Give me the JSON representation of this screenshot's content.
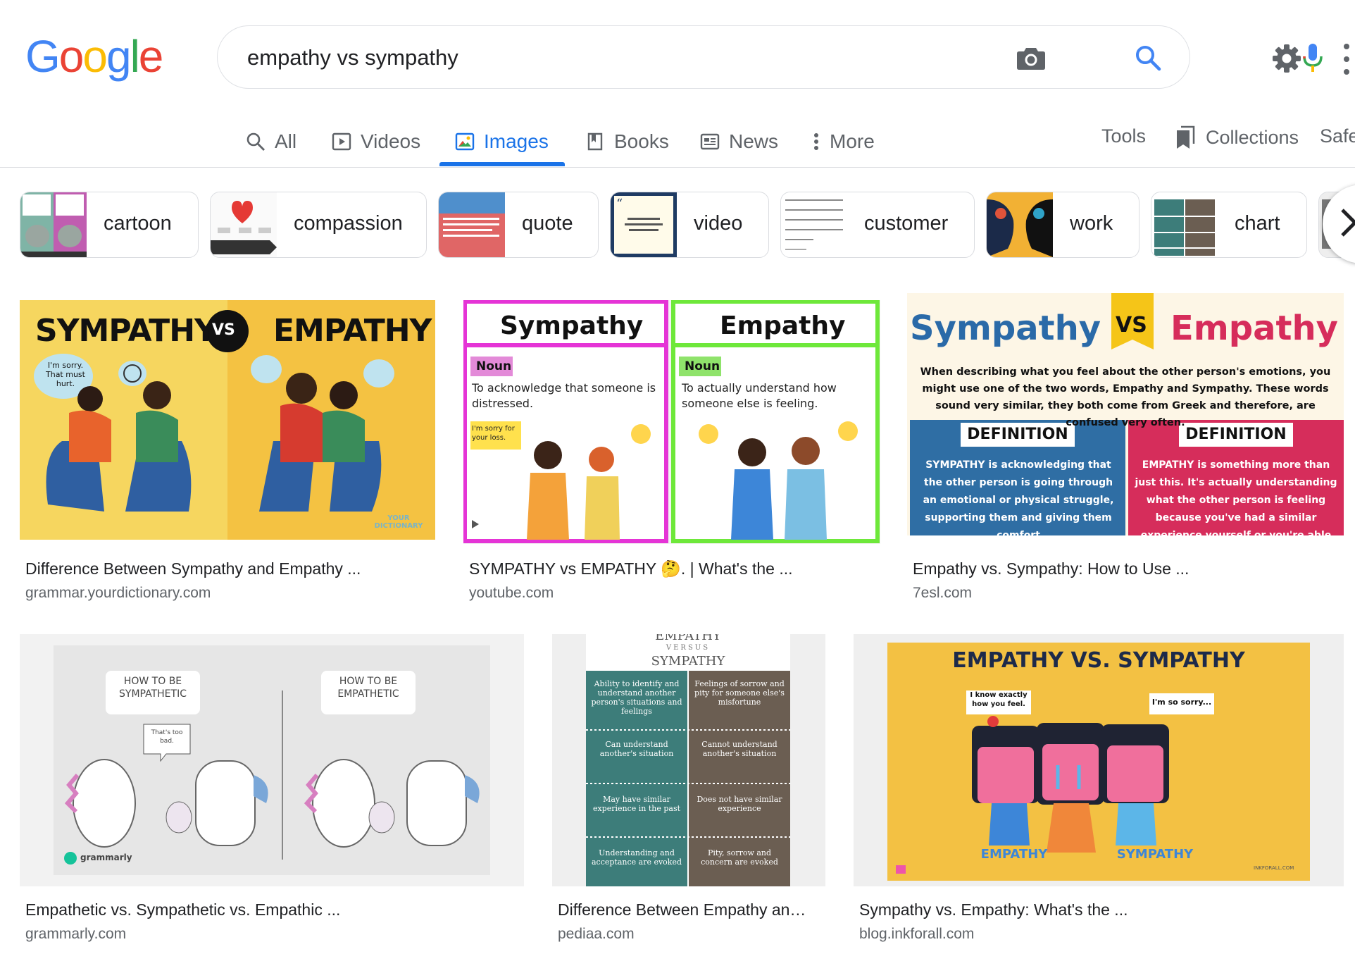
{
  "header": {
    "logo_letters": [
      {
        "ch": "G",
        "color": "#4285F4"
      },
      {
        "ch": "o",
        "color": "#EA4335"
      },
      {
        "ch": "o",
        "color": "#FBBC05"
      },
      {
        "ch": "g",
        "color": "#4285F4"
      },
      {
        "ch": "l",
        "color": "#34A853"
      },
      {
        "ch": "e",
        "color": "#EA4335"
      }
    ],
    "query": "empathy vs sympathy",
    "icons": [
      "camera-icon",
      "microphone-icon",
      "search-icon",
      "gear-icon",
      "apps-menu-icon"
    ]
  },
  "tabs": {
    "all": "All",
    "videos": "Videos",
    "images": "Images",
    "books": "Books",
    "news": "News",
    "more": "More",
    "tools": "Tools",
    "collections": "Collections",
    "safesearch": "Safe"
  },
  "chips": [
    {
      "label": "cartoon"
    },
    {
      "label": "compassion"
    },
    {
      "label": "quote"
    },
    {
      "label": "video"
    },
    {
      "label": "customer"
    },
    {
      "label": "work"
    },
    {
      "label": "chart"
    }
  ],
  "results": [
    {
      "title": "Difference Between Sympathy and Empathy ...",
      "source": "grammar.yourdictionary.com",
      "img": {
        "left_word": "SYMPATHY",
        "vs": "VS",
        "right_word": "EMPATHY",
        "bubble_left": "I'm sorry. That must hurt.",
        "watermark": "YOUR DICTIONARY"
      }
    },
    {
      "title": "SYMPATHY vs EMPATHY 🤔. | What's the ...",
      "source": "youtube.com",
      "img": {
        "left_word": "Sympathy",
        "right_word": "Empathy",
        "pos": "Noun",
        "left_def": "To acknowledge that someone is distressed.",
        "right_def": "To actually understand how someone else is feeling.",
        "bubble": "I'm sorry for your loss."
      }
    },
    {
      "title": "Empathy vs. Sympathy: How to Use ...",
      "source": "7esl.com",
      "img": {
        "left_word": "Sympathy",
        "vs": "VS",
        "right_word": "Empathy",
        "intro": "When describing what you feel about the other person's emotions, you might use one of the two words, Empathy and Sympathy. These words sound very similar, they both come from Greek and therefore, are confused very often.",
        "def_label": "DEFINITION",
        "left_def": "SYMPATHY is acknowledging that the other person is going through an emotional or physical struggle, supporting them and giving them comfort",
        "right_def": "EMPATHY is something more than just this. It's actually understanding what the other person is feeling because you've had a similar experience yourself or you're able to put yourself in their"
      }
    },
    {
      "title": "Empathetic vs. Sympathetic vs. Empathic ...",
      "source": "grammarly.com",
      "img": {
        "left_card": "HOW TO BE SYMPATHETIC",
        "right_card": "HOW TO BE EMPATHETIC",
        "bubble": "That's too bad.",
        "brand": "grammarly"
      }
    },
    {
      "title": "Difference Between Empathy an…",
      "source": "pediaa.com",
      "img": {
        "top": "EMPATHY",
        "versus": "VERSUS",
        "bottom": "SYMPATHY",
        "rows": [
          [
            "Ability to identify and understand another person's situations and feelings",
            "Feelings of sorrow and pity for someone else's misfortune"
          ],
          [
            "Can understand another's situation",
            "Cannot understand another's situation"
          ],
          [
            "May have similar experience in the past",
            "Does not have similar experience"
          ],
          [
            "Understanding and acceptance are evoked",
            "Pity, sorrow and concern are evoked"
          ]
        ]
      }
    },
    {
      "title": "Sympathy vs. Empathy: What's the ...",
      "source": "blog.inkforall.com",
      "img": {
        "heading": "EMPATHY VS. SYMPATHY",
        "bubble_left": "I know exactly how you feel.",
        "bubble_right": "I'm so sorry...",
        "left_label": "EMPATHY",
        "right_label": "SYMPATHY",
        "watermark": "INKFORALL.COM"
      }
    }
  ]
}
